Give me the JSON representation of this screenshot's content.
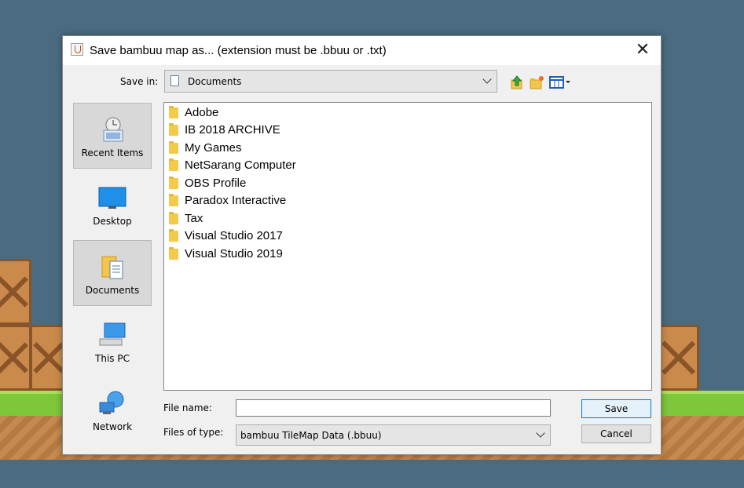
{
  "dialog": {
    "title": "Save bambuu map as... (extension must be .bbuu or .txt)",
    "close_glyph": "✕"
  },
  "save_in": {
    "label": "Save in:",
    "value": "Documents"
  },
  "toolbar": {
    "icons": [
      "up-one-level-icon",
      "create-new-folder-icon",
      "view-menu-icon"
    ]
  },
  "places": [
    {
      "label": "Recent Items",
      "icon": "recent-items-icon",
      "selected": true
    },
    {
      "label": "Desktop",
      "icon": "desktop-icon",
      "selected": false
    },
    {
      "label": "Documents",
      "icon": "documents-icon",
      "selected": true
    },
    {
      "label": "This PC",
      "icon": "this-pc-icon",
      "selected": false
    },
    {
      "label": "Network",
      "icon": "network-icon",
      "selected": false
    }
  ],
  "files": [
    "Adobe",
    "IB 2018 ARCHIVE",
    "My Games",
    "NetSarang Computer",
    "OBS Profile",
    "Paradox Interactive",
    "Tax",
    "Visual Studio 2017",
    "Visual Studio 2019"
  ],
  "file_name": {
    "label": "File name:",
    "value": ""
  },
  "file_type": {
    "label": "Files of type:",
    "value": "bambuu TileMap Data (.bbuu)"
  },
  "buttons": {
    "save": "Save",
    "cancel": "Cancel"
  },
  "colors": {
    "background": "#4a6b80",
    "dialog": "#f0f0f0",
    "accent": "#0078d7"
  }
}
